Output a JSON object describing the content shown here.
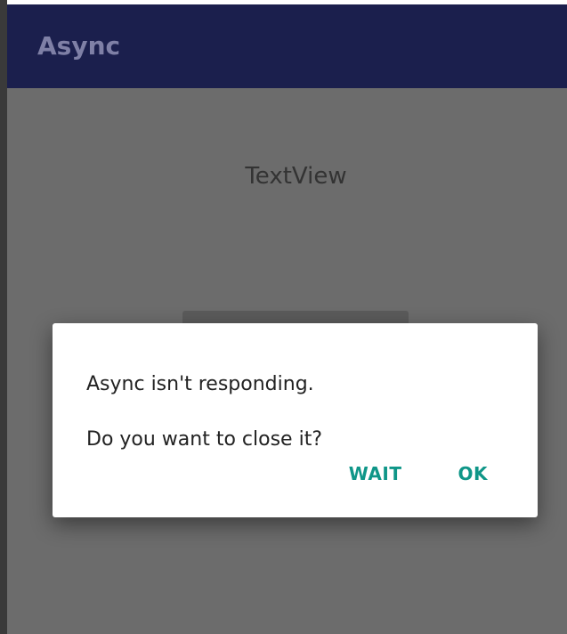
{
  "app_bar": {
    "title": "Async"
  },
  "content": {
    "text_view": "TextView"
  },
  "dialog": {
    "message_line1": "Async isn't responding.",
    "message_line2": "Do you want to close it?",
    "wait_label": "WAIT",
    "ok_label": "OK"
  },
  "colors": {
    "app_bar": "#1b1f4d",
    "scrim_background": "#6c6c6c",
    "accent": "#0f9688"
  }
}
